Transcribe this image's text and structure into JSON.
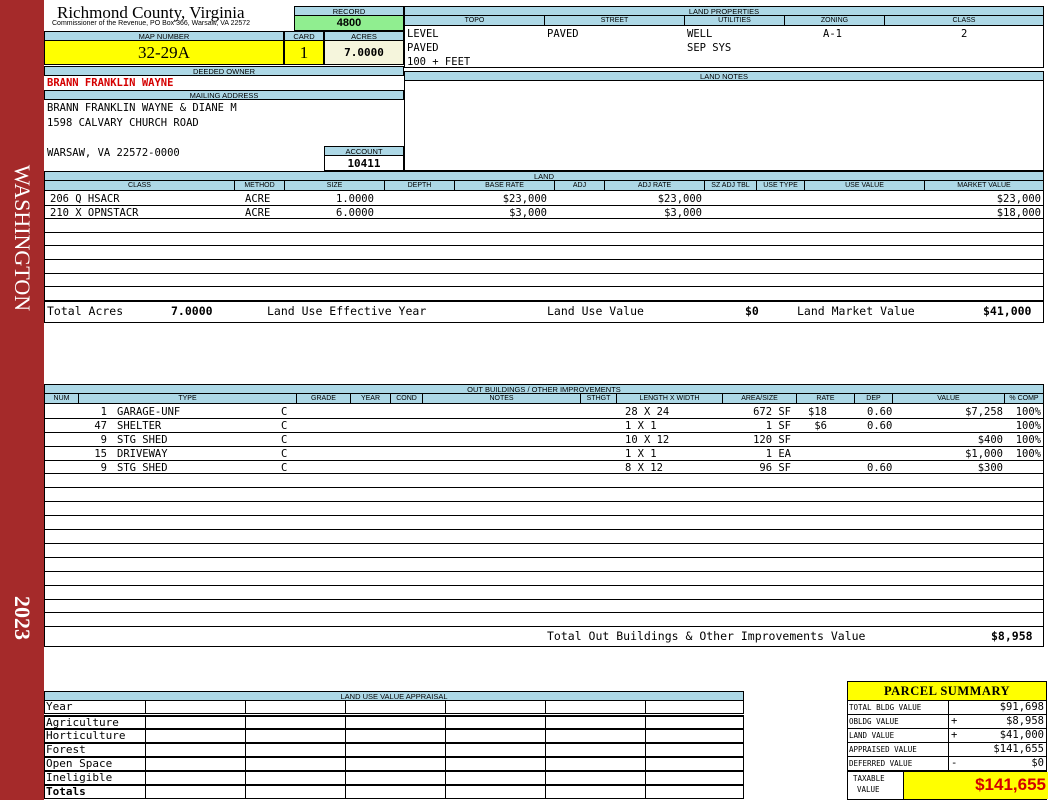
{
  "side": {
    "area": "WASHINGTON",
    "year": "2023"
  },
  "header": {
    "county": "Richmond County, Virginia",
    "commissioner": "Commissioner of the Revenue, PO Box 366, Warsaw, VA 22572",
    "record_label": "RECORD",
    "record": "4800",
    "map_label": "MAP NUMBER",
    "map_number": "32-29A",
    "card_label": "CARD",
    "card": "1",
    "acres_label": "ACRES",
    "acres": "7.0000"
  },
  "owner": {
    "deeded_label": "DEEDED OWNER",
    "deeded_owner": "BRANN FRANKLIN WAYNE",
    "mailing_label": "MAILING ADDRESS",
    "address_lines": [
      "BRANN FRANKLIN WAYNE & DIANE M",
      "1598 CALVARY CHURCH ROAD",
      "",
      "WARSAW, VA 22572-0000"
    ],
    "account_label": "ACCOUNT",
    "account": "10411"
  },
  "land_properties": {
    "title": "LAND PROPERTIES",
    "headers": [
      "TOPO",
      "STREET",
      "UTILITIES",
      "ZONING",
      "CLASS"
    ],
    "topo": [
      "LEVEL",
      "PAVED",
      "100 + FEET"
    ],
    "street": [
      "PAVED"
    ],
    "utilities": [
      "WELL",
      "SEP SYS"
    ],
    "zoning": "A-1",
    "class": "2"
  },
  "land_notes": {
    "title": "LAND NOTES"
  },
  "land": {
    "title": "LAND",
    "headers": [
      "CLASS",
      "METHOD",
      "SIZE",
      "DEPTH",
      "BASE RATE",
      "ADJ",
      "ADJ RATE",
      "SZ ADJ TBL",
      "USE TYPE",
      "USE VALUE",
      "MARKET VALUE"
    ],
    "rows": [
      {
        "class": "206 Q HSACR",
        "method": "ACRE",
        "size": "1.0000",
        "base_rate": "$23,000",
        "adj_rate": "$23,000",
        "market": "$23,000"
      },
      {
        "class": "210 X OPNSTACR",
        "method": "ACRE",
        "size": "6.0000",
        "base_rate": "$3,000",
        "adj_rate": "$3,000",
        "market": "$18,000"
      }
    ],
    "total_acres_label": "Total Acres",
    "total_acres": "7.0000",
    "effective_label": "Land Use Effective Year",
    "use_value_label": "Land Use Value",
    "use_value": "$0",
    "market_label": "Land Market Value",
    "market_value": "$41,000"
  },
  "outbuildings": {
    "title": "OUT BUILDINGS / OTHER IMPROVEMENTS",
    "headers": [
      "NUM",
      "TYPE",
      "GRADE",
      "YEAR",
      "COND",
      "NOTES",
      "STHGT",
      "LENGTH X WIDTH",
      "AREA/SIZE",
      "RATE",
      "DEP",
      "VALUE",
      "% COMP"
    ],
    "rows": [
      {
        "code": "1",
        "type": "GARAGE-UNF",
        "grade": "C",
        "dim": "28 X 24",
        "area": "672 SF",
        "rate": "$18",
        "dep": "0.60",
        "value": "$7,258",
        "comp": "100%"
      },
      {
        "code": "47",
        "type": "SHELTER",
        "grade": "C",
        "dim": "1 X 1",
        "area": "1 SF",
        "rate": "$6",
        "dep": "0.60",
        "value": "",
        "comp": "100%"
      },
      {
        "code": "9",
        "type": "STG SHED",
        "grade": "C",
        "dim": "10 X 12",
        "area": "120 SF",
        "rate": "",
        "dep": "",
        "value": "$400",
        "comp": "100%"
      },
      {
        "code": "15",
        "type": "DRIVEWAY",
        "grade": "C",
        "dim": "1 X 1",
        "area": "1 EA",
        "rate": "",
        "dep": "",
        "value": "$1,000",
        "comp": "100%"
      },
      {
        "code": "9",
        "type": "STG SHED",
        "grade": "C",
        "dim": "8 X 12",
        "area": "96 SF",
        "rate": "",
        "dep": "0.60",
        "value": "$300",
        "comp": ""
      }
    ],
    "total_label": "Total Out Buildings & Other Improvements Value",
    "total": "$8,958"
  },
  "land_use_appraisal": {
    "title": "LAND USE VALUE APPRAISAL",
    "rows": [
      "Year",
      "Agriculture",
      "Horticulture",
      "Forest",
      "Open Space",
      "Ineligible",
      "Totals"
    ]
  },
  "summary": {
    "title": "PARCEL SUMMARY",
    "rows": [
      {
        "label": "TOTAL BLDG VALUE",
        "sign": "",
        "value": "$91,698"
      },
      {
        "label": "OBLDG VALUE",
        "sign": "+",
        "value": "$8,958"
      },
      {
        "label": "LAND VALUE",
        "sign": "+",
        "value": "$41,000"
      },
      {
        "label": "APPRAISED VALUE",
        "sign": "",
        "value": "$141,655"
      },
      {
        "label": "DEFERRED VALUE",
        "sign": "-",
        "value": "$0"
      }
    ],
    "taxable_label_1": "TAXABLE",
    "taxable_label_2": "VALUE",
    "taxable": "$141,655"
  }
}
